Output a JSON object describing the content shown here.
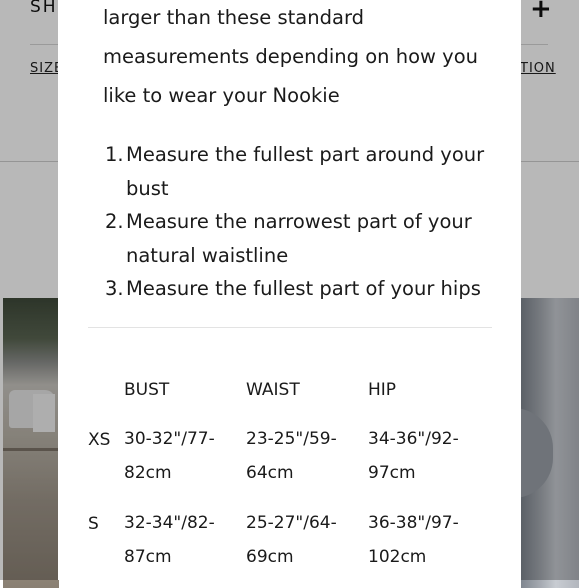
{
  "background": {
    "section_title_partial": "SH",
    "expand_symbol": "+",
    "size_link_partial": "SIZE",
    "right_link_partial": "TION"
  },
  "modal": {
    "intro_lines": [
      "larger than these standard",
      "measurements depending on how you",
      "like to wear your Nookie"
    ],
    "steps": [
      {
        "num": "1.",
        "lines": [
          "Measure the fullest part around your",
          "bust"
        ]
      },
      {
        "num": "2.",
        "lines": [
          "Measure the narrowest part of your",
          "natural waistline"
        ]
      },
      {
        "num": "3.",
        "lines": [
          "Measure the fullest part of your hips"
        ]
      }
    ],
    "size_table": {
      "headers": [
        "BUST",
        "WAIST",
        "HIP"
      ],
      "rows": [
        {
          "size": "XS",
          "bust": [
            "30-32\"/77-",
            "82cm"
          ],
          "waist": [
            "23-25\"/59-",
            "64cm"
          ],
          "hip": [
            "34-36\"/92-",
            "97cm"
          ]
        },
        {
          "size": "S",
          "bust": [
            "32-34\"/82-",
            "87cm"
          ],
          "waist": [
            "25-27\"/64-",
            "69cm"
          ],
          "hip": [
            "36-38\"/97-",
            "102cm"
          ]
        }
      ]
    }
  },
  "colors": {
    "overlay": "rgba(0,0,0,0.28)",
    "text": "#1a1a1a",
    "modal_background": "#ffffff"
  }
}
